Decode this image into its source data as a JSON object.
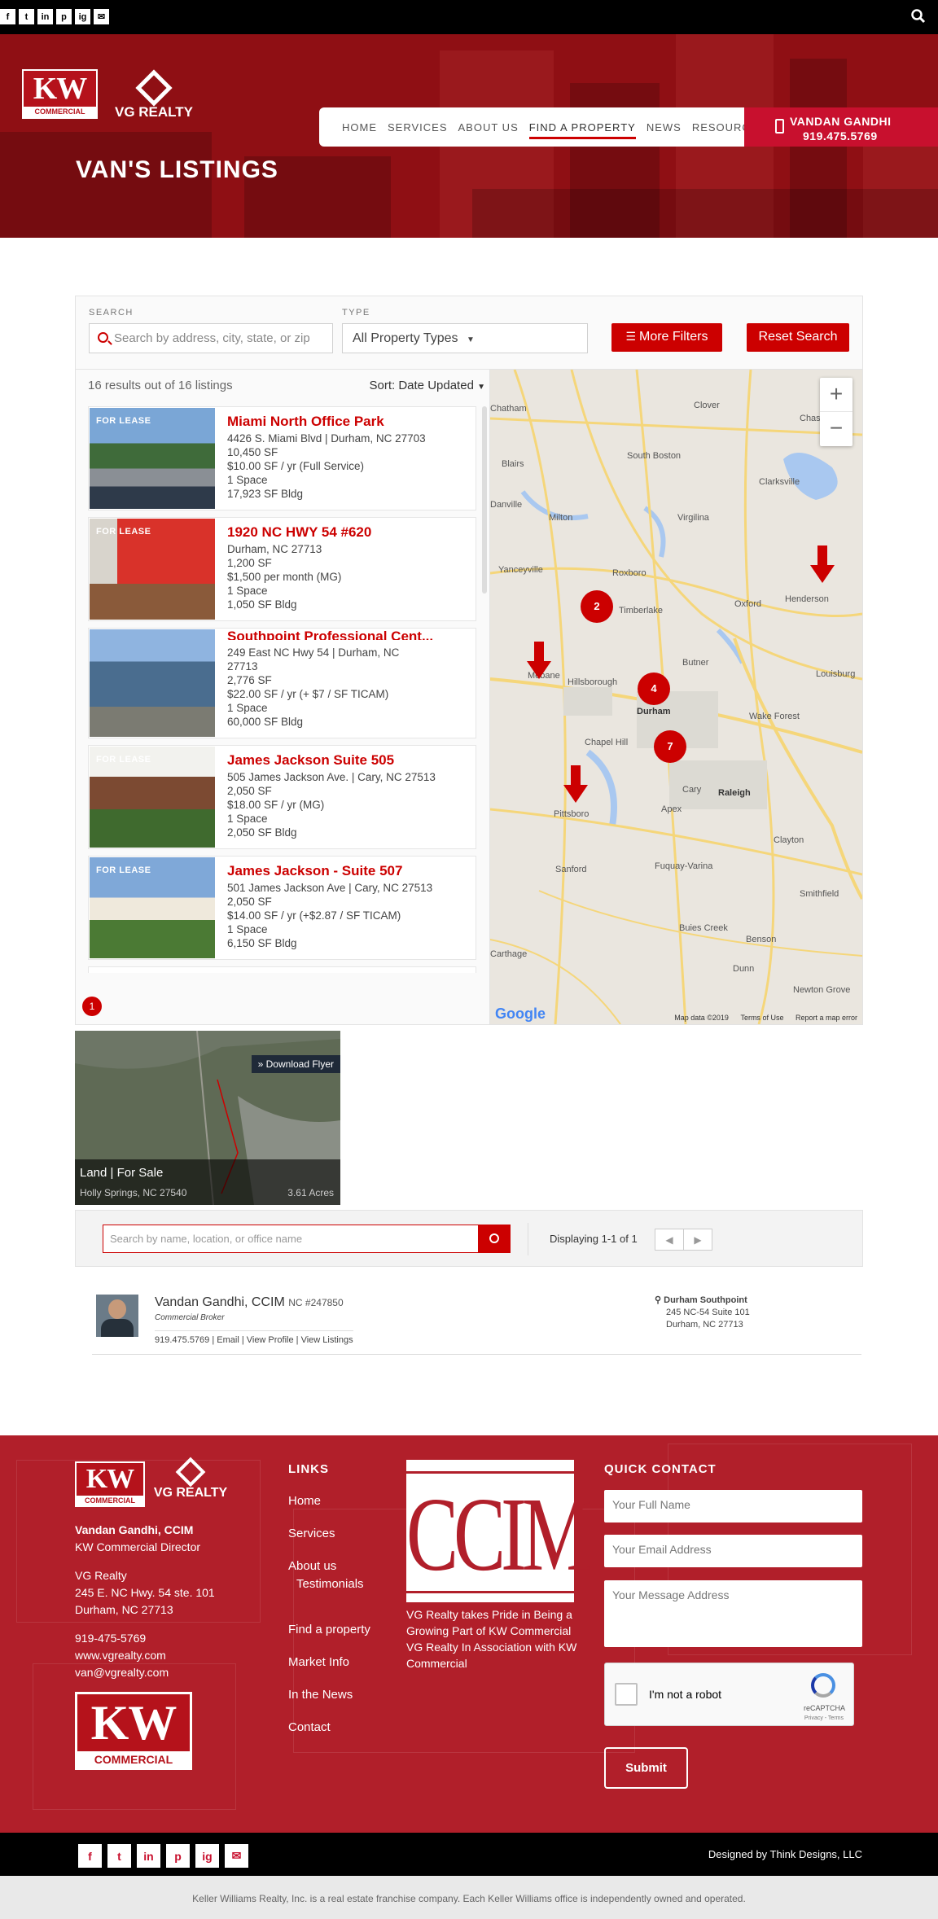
{
  "topbar": {
    "social": [
      "f",
      "t",
      "in",
      "p",
      "ig",
      "✉"
    ],
    "social_names": [
      "facebook-icon",
      "twitter-icon",
      "linkedin-icon",
      "pinterest-icon",
      "instagram-icon",
      "email-icon"
    ]
  },
  "brand": {
    "kw": "KW",
    "commercial": "COMMERCIAL",
    "vg": "VG REALTY"
  },
  "nav": {
    "items": [
      "HOME",
      "SERVICES",
      "ABOUT US",
      "FIND A PROPERTY",
      "NEWS",
      "RESOURCES"
    ],
    "active": "FIND A PROPERTY"
  },
  "contact": {
    "name": "VANDAN GANDHI",
    "phone": "919.475.5769"
  },
  "hero": {
    "title": "VAN'S LISTINGS"
  },
  "filters": {
    "search_label": "SEARCH",
    "search_placeholder": "Search by address, city, state, or zip",
    "type_label": "TYPE",
    "type_value": "All Property Types",
    "more_filters": "More Filters",
    "reset": "Reset Search"
  },
  "results": {
    "summary": "16 results out of 16 listings",
    "sort": "Sort: Date Updated",
    "page": "1"
  },
  "listings": [
    {
      "badge": "FOR LEASE",
      "title": "Miami North Office Park",
      "lines": [
        "4426 S. Miami Blvd | Durham, NC 27703",
        "10,450 SF",
        "$10.00 SF / yr (Full Service)",
        "1 Space",
        "17,923 SF Bldg"
      ]
    },
    {
      "badge": "FOR LEASE",
      "title": "1920 NC HWY 54 #620",
      "lines": [
        "Durham, NC 27713",
        "1,200 SF",
        "$1,500 per month (MG)",
        "1 Space",
        "1,050 SF Bldg"
      ]
    },
    {
      "badge": "",
      "title": "Southpoint Professional Cent...",
      "lines": [
        "249 East NC Hwy 54 | Durham, NC",
        "27713",
        "2,776 SF",
        "$22.00 SF / yr (+ $7 / SF TICAM)",
        "1 Space",
        "60,000 SF Bldg"
      ]
    },
    {
      "badge": "FOR LEASE",
      "title": "James Jackson Suite 505",
      "lines": [
        "505 James Jackson Ave. | Cary, NC 27513",
        "2,050 SF",
        "$18.00 SF / yr (MG)",
        "1 Space",
        "2,050 SF Bldg"
      ]
    },
    {
      "badge": "FOR LEASE",
      "title": "James Jackson - Suite 507",
      "lines": [
        "501 James Jackson Ave | Cary, NC 27513",
        "2,050 SF",
        "$14.00 SF / yr (+$2.87 / SF TICAM)",
        "1 Space",
        "6,150 SF Bldg"
      ]
    }
  ],
  "map": {
    "zoom_in": "+",
    "zoom_out": "−",
    "clusters": [
      "2",
      "4",
      "7"
    ],
    "places": [
      "Chatham",
      "Clover",
      "Chase City",
      "Blairs",
      "South Boston",
      "Clarksville",
      "Danville",
      "Milton",
      "Virgilina",
      "Yanceyville",
      "Roxboro",
      "Oxford",
      "Henderson",
      "Timberlake",
      "Butner",
      "Louisburg",
      "Mebane",
      "Hillsborough",
      "Durham",
      "Wake Forest",
      "Chapel Hill",
      "Cary",
      "Raleigh",
      "Pittsboro",
      "Apex",
      "Clayton",
      "Fuquay-Varina",
      "Sanford",
      "Smithfield",
      "Buies Creek",
      "Benson",
      "Dunn",
      "Newton Grove",
      "Carthage"
    ],
    "google": "Google",
    "data": "Map data ©2019",
    "terms": "Terms of Use",
    "report": "Report a map error"
  },
  "featured": {
    "flyer": "» Download Flyer",
    "type": "Land | For Sale",
    "location": "Holly Springs, NC 27540",
    "size": "3.61 Acres"
  },
  "agent_search": {
    "placeholder": "Search by name, location, or office name",
    "displaying": "Displaying 1-1 of 1",
    "prev": "◀",
    "next": "▶"
  },
  "agent": {
    "name": "Vandan Gandhi, CCIM",
    "license": "NC #247850",
    "role": "Commercial Broker",
    "links": "919.475.5769 | Email | View Profile | View Listings",
    "office_name": "Durham Southpoint",
    "office_addr1": "245 NC-54 Suite 101",
    "office_addr2": "Durham, NC 27713"
  },
  "footer": {
    "name": "Vandan Gandhi, CCIM",
    "title": "KW Commercial Director",
    "company": "VG Realty",
    "addr1": "245 E. NC Hwy. 54 ste. 101",
    "addr2": "Durham, NC 27713",
    "phone": "919-475-5769",
    "web": "www.vgrealty.com",
    "email": "van@vgrealty.com",
    "links_heading": "LINKS",
    "links": [
      "Home",
      "Services",
      "About us",
      "Testimonials",
      "Find a property",
      "Market Info",
      "In the News",
      "Contact"
    ],
    "ccim_logo": "CCIM",
    "ccim_caption": "VG Realty takes Pride in Being a Growing Part of KW Commercial VG Realty In Association with KW Commercial",
    "qc_heading": "QUICK CONTACT",
    "qc_name": "Your Full Name",
    "qc_email": "Your Email Address",
    "qc_message": "Your Message Address",
    "captcha": "I'm not a robot",
    "captcha_brand": "reCAPTCHA",
    "captcha_terms": "Privacy - Terms",
    "submit": "Submit"
  },
  "bottombar": {
    "social": [
      "f",
      "t",
      "in",
      "p",
      "ig",
      "✉"
    ],
    "credit": "Designed by Think Designs, LLC"
  },
  "legal": "Keller Williams Realty, Inc. is a real estate franchise company. Each Keller Williams office is independently owned and operated.",
  "colors": {
    "brand_red": "#c8102e",
    "dark_red": "#8f0f14",
    "footer_red": "#b11f2a"
  }
}
